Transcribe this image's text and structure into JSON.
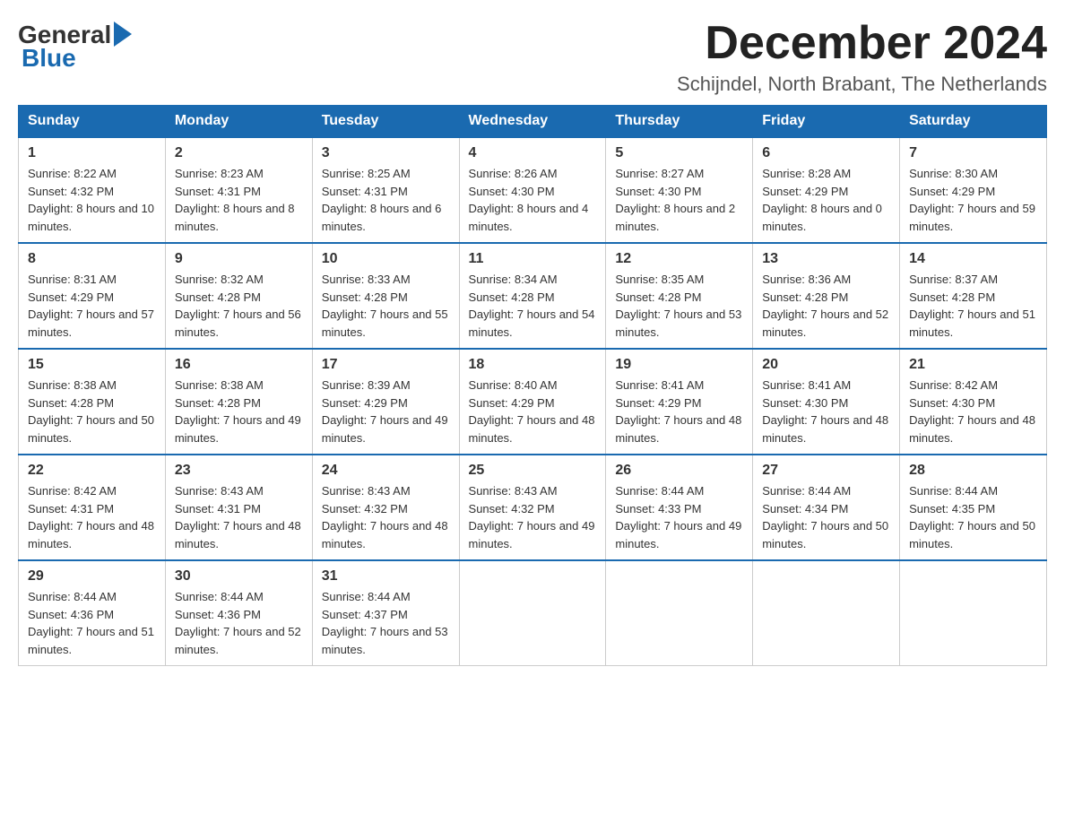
{
  "logo": {
    "general_text": "General",
    "blue_text": "Blue"
  },
  "header": {
    "month_year": "December 2024",
    "location": "Schijndel, North Brabant, The Netherlands"
  },
  "weekdays": [
    "Sunday",
    "Monday",
    "Tuesday",
    "Wednesday",
    "Thursday",
    "Friday",
    "Saturday"
  ],
  "weeks": [
    [
      {
        "day": "1",
        "sunrise": "8:22 AM",
        "sunset": "4:32 PM",
        "daylight": "8 hours and 10 minutes."
      },
      {
        "day": "2",
        "sunrise": "8:23 AM",
        "sunset": "4:31 PM",
        "daylight": "8 hours and 8 minutes."
      },
      {
        "day": "3",
        "sunrise": "8:25 AM",
        "sunset": "4:31 PM",
        "daylight": "8 hours and 6 minutes."
      },
      {
        "day": "4",
        "sunrise": "8:26 AM",
        "sunset": "4:30 PM",
        "daylight": "8 hours and 4 minutes."
      },
      {
        "day": "5",
        "sunrise": "8:27 AM",
        "sunset": "4:30 PM",
        "daylight": "8 hours and 2 minutes."
      },
      {
        "day": "6",
        "sunrise": "8:28 AM",
        "sunset": "4:29 PM",
        "daylight": "8 hours and 0 minutes."
      },
      {
        "day": "7",
        "sunrise": "8:30 AM",
        "sunset": "4:29 PM",
        "daylight": "7 hours and 59 minutes."
      }
    ],
    [
      {
        "day": "8",
        "sunrise": "8:31 AM",
        "sunset": "4:29 PM",
        "daylight": "7 hours and 57 minutes."
      },
      {
        "day": "9",
        "sunrise": "8:32 AM",
        "sunset": "4:28 PM",
        "daylight": "7 hours and 56 minutes."
      },
      {
        "day": "10",
        "sunrise": "8:33 AM",
        "sunset": "4:28 PM",
        "daylight": "7 hours and 55 minutes."
      },
      {
        "day": "11",
        "sunrise": "8:34 AM",
        "sunset": "4:28 PM",
        "daylight": "7 hours and 54 minutes."
      },
      {
        "day": "12",
        "sunrise": "8:35 AM",
        "sunset": "4:28 PM",
        "daylight": "7 hours and 53 minutes."
      },
      {
        "day": "13",
        "sunrise": "8:36 AM",
        "sunset": "4:28 PM",
        "daylight": "7 hours and 52 minutes."
      },
      {
        "day": "14",
        "sunrise": "8:37 AM",
        "sunset": "4:28 PM",
        "daylight": "7 hours and 51 minutes."
      }
    ],
    [
      {
        "day": "15",
        "sunrise": "8:38 AM",
        "sunset": "4:28 PM",
        "daylight": "7 hours and 50 minutes."
      },
      {
        "day": "16",
        "sunrise": "8:38 AM",
        "sunset": "4:28 PM",
        "daylight": "7 hours and 49 minutes."
      },
      {
        "day": "17",
        "sunrise": "8:39 AM",
        "sunset": "4:29 PM",
        "daylight": "7 hours and 49 minutes."
      },
      {
        "day": "18",
        "sunrise": "8:40 AM",
        "sunset": "4:29 PM",
        "daylight": "7 hours and 48 minutes."
      },
      {
        "day": "19",
        "sunrise": "8:41 AM",
        "sunset": "4:29 PM",
        "daylight": "7 hours and 48 minutes."
      },
      {
        "day": "20",
        "sunrise": "8:41 AM",
        "sunset": "4:30 PM",
        "daylight": "7 hours and 48 minutes."
      },
      {
        "day": "21",
        "sunrise": "8:42 AM",
        "sunset": "4:30 PM",
        "daylight": "7 hours and 48 minutes."
      }
    ],
    [
      {
        "day": "22",
        "sunrise": "8:42 AM",
        "sunset": "4:31 PM",
        "daylight": "7 hours and 48 minutes."
      },
      {
        "day": "23",
        "sunrise": "8:43 AM",
        "sunset": "4:31 PM",
        "daylight": "7 hours and 48 minutes."
      },
      {
        "day": "24",
        "sunrise": "8:43 AM",
        "sunset": "4:32 PM",
        "daylight": "7 hours and 48 minutes."
      },
      {
        "day": "25",
        "sunrise": "8:43 AM",
        "sunset": "4:32 PM",
        "daylight": "7 hours and 49 minutes."
      },
      {
        "day": "26",
        "sunrise": "8:44 AM",
        "sunset": "4:33 PM",
        "daylight": "7 hours and 49 minutes."
      },
      {
        "day": "27",
        "sunrise": "8:44 AM",
        "sunset": "4:34 PM",
        "daylight": "7 hours and 50 minutes."
      },
      {
        "day": "28",
        "sunrise": "8:44 AM",
        "sunset": "4:35 PM",
        "daylight": "7 hours and 50 minutes."
      }
    ],
    [
      {
        "day": "29",
        "sunrise": "8:44 AM",
        "sunset": "4:36 PM",
        "daylight": "7 hours and 51 minutes."
      },
      {
        "day": "30",
        "sunrise": "8:44 AM",
        "sunset": "4:36 PM",
        "daylight": "7 hours and 52 minutes."
      },
      {
        "day": "31",
        "sunrise": "8:44 AM",
        "sunset": "4:37 PM",
        "daylight": "7 hours and 53 minutes."
      },
      null,
      null,
      null,
      null
    ]
  ]
}
